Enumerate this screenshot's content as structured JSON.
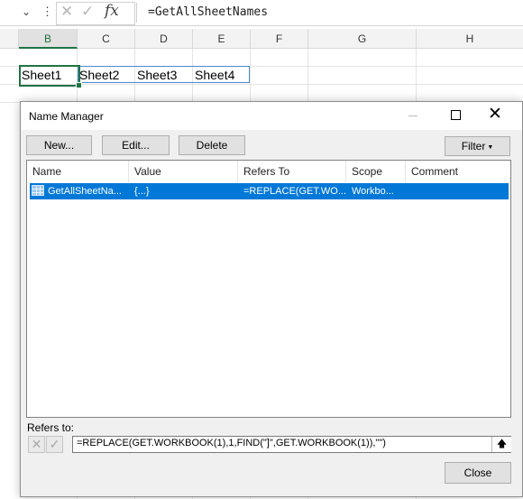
{
  "formula_bar": {
    "formula": "=GetAllSheetNames",
    "fx_label": "fx",
    "cancel_glyph": "✕",
    "enter_glyph": "✓"
  },
  "sheet": {
    "columns": [
      "B",
      "C",
      "D",
      "E",
      "F",
      "G",
      "H"
    ],
    "selected_column": "B",
    "row_values": [
      "Sheet1",
      "Sheet2",
      "Sheet3",
      "Sheet4"
    ]
  },
  "dialog": {
    "title": "Name Manager",
    "buttons": {
      "new": "New...",
      "edit": "Edit...",
      "delete": "Delete",
      "filter": "Filter",
      "close": "Close"
    },
    "columns": [
      "Name",
      "Value",
      "Refers To",
      "Scope",
      "Comment"
    ],
    "rows": [
      {
        "name": "GetAllSheetNa...",
        "value": "{...}",
        "refers_to": "=REPLACE(GET.WO...",
        "scope": "Workbo...",
        "comment": "",
        "icon": "named-range-table-icon"
      }
    ],
    "refers_to_label": "Refers to:",
    "refers_to_value": "=REPLACE(GET.WORKBOOK(1),1,FIND(\"]\",GET.WORKBOOK(1)),\"\")"
  },
  "colors": {
    "selection_blue": "#0078d7",
    "excel_green": "#217346"
  }
}
